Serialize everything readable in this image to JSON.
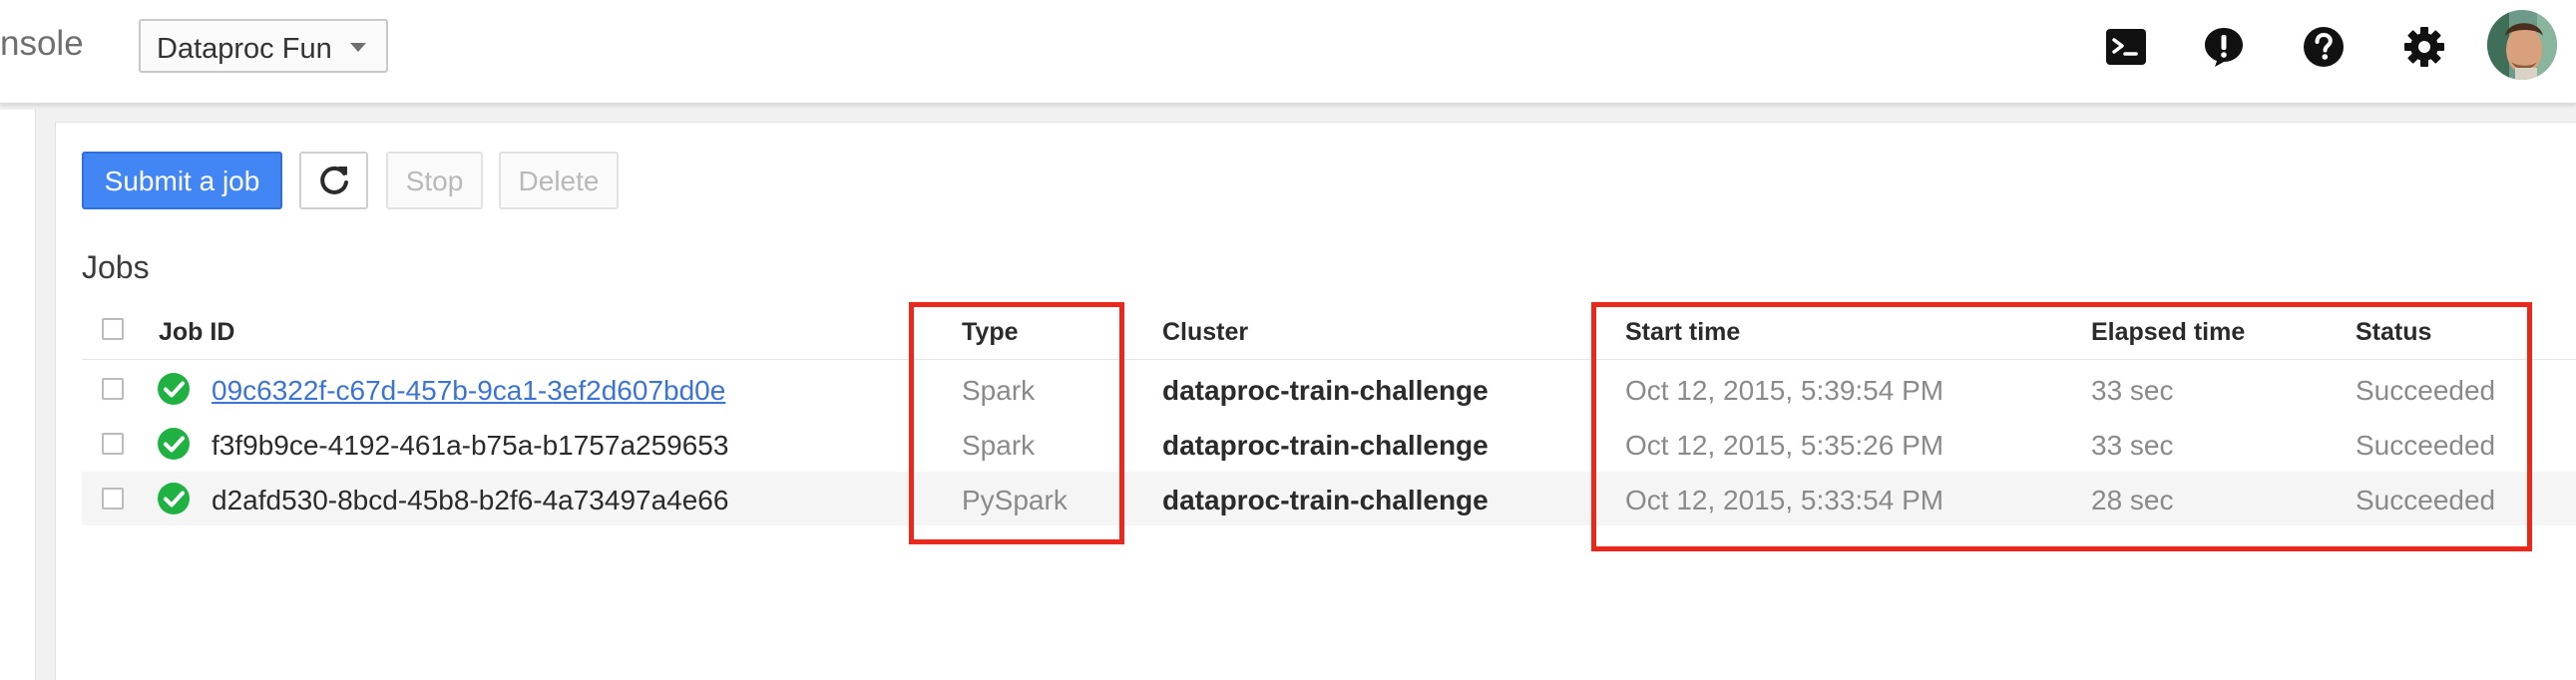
{
  "header": {
    "app_title": "nsole",
    "project_selector": "Dataproc Fun",
    "icons": [
      "cloud-shell-icon",
      "notifications-icon",
      "help-icon",
      "settings-icon",
      "avatar"
    ]
  },
  "toolbar": {
    "submit_label": "Submit a job",
    "refresh_icon": "refresh-icon",
    "stop_label": "Stop",
    "delete_label": "Delete"
  },
  "section_title": "Jobs",
  "table": {
    "headers": {
      "job_id": "Job ID",
      "type": "Type",
      "cluster": "Cluster",
      "start_time": "Start time",
      "elapsed_time": "Elapsed time",
      "status": "Status"
    },
    "rows": [
      {
        "job_id": "09c6322f-c67d-457b-9ca1-3ef2d607bd0e",
        "type": "Spark",
        "cluster": "dataproc-train-challenge",
        "start_time": "Oct 12, 2015, 5:39:54 PM",
        "elapsed_time": "33 sec",
        "status": "Succeeded"
      },
      {
        "job_id": "f3f9b9ce-4192-461a-b75a-b1757a259653",
        "type": "Spark",
        "cluster": "dataproc-train-challenge",
        "start_time": "Oct 12, 2015, 5:35:26 PM",
        "elapsed_time": "33 sec",
        "status": "Succeeded"
      },
      {
        "job_id": "d2afd530-8bcd-45b8-b2f6-4a73497a4e66",
        "type": "PySpark",
        "cluster": "dataproc-train-challenge",
        "start_time": "Oct 12, 2015, 5:33:54 PM",
        "elapsed_time": "28 sec",
        "status": "Succeeded"
      }
    ]
  },
  "colors": {
    "primary": "#4285f4",
    "success": "#1fb141",
    "annotation": "#e8291c",
    "link": "#3b73d8"
  }
}
